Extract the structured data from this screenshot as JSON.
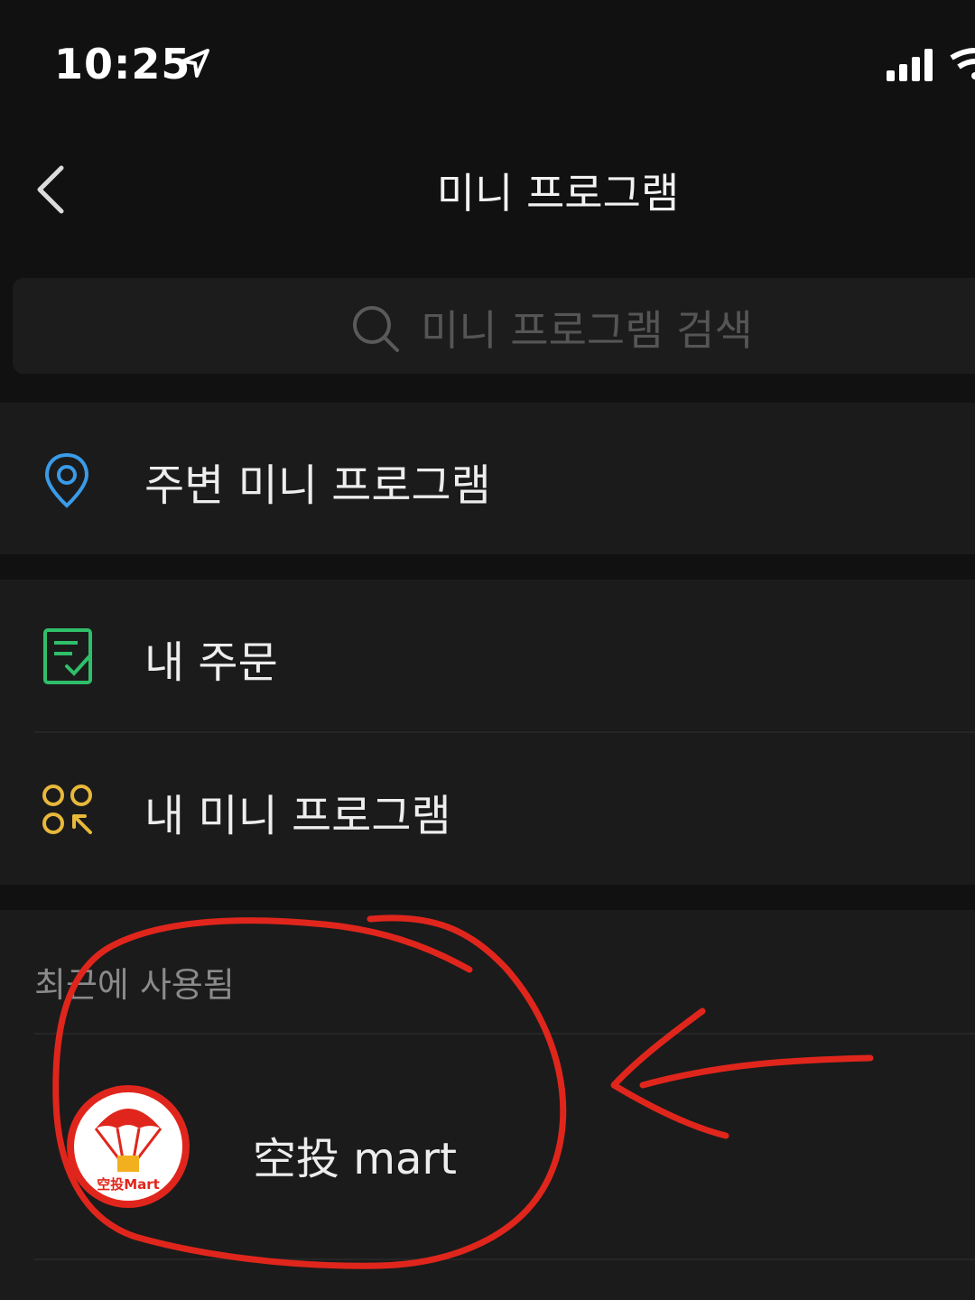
{
  "status_bar": {
    "time": "10:25"
  },
  "nav": {
    "title": "미니 프로그램"
  },
  "search": {
    "placeholder": "미니 프로그램 검색"
  },
  "menu": {
    "nearby_label": "주변 미니 프로그램",
    "orders_label": "내 주문",
    "my_programs_label": "내 미니 프로그램"
  },
  "recent": {
    "section_label": "최근에 사용됨",
    "items": [
      {
        "name": "空投 mart",
        "logo_text": "空投Mart"
      }
    ]
  },
  "colors": {
    "background": "#111111",
    "group": "#1b1b1b",
    "location_icon": "#3a9be8",
    "orders_icon": "#2fbf6a",
    "programs_icon": "#e8b83a",
    "annotation": "#e0261c"
  }
}
